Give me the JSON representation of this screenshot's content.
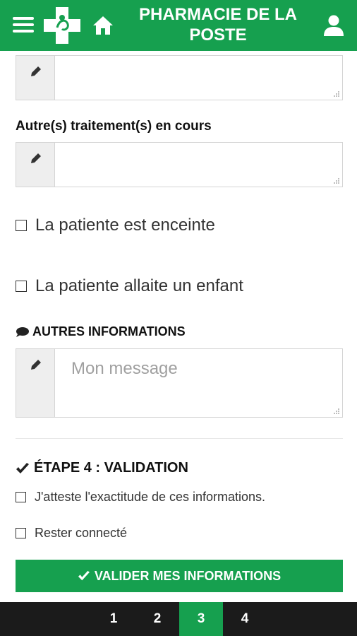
{
  "header": {
    "title": "PHARMACIE DE LA POSTE",
    "icons": {
      "menu": "hamburger-menu-icon",
      "logo": "pharmacy-cross-logo",
      "home": "home-icon",
      "user": "user-icon"
    }
  },
  "form": {
    "top_textarea": {
      "value": ""
    },
    "treatments": {
      "label": "Autre(s) traitement(s) en cours",
      "value": ""
    },
    "pregnant": {
      "label": "La patiente est enceinte",
      "checked": false
    },
    "breastfeeding": {
      "label": "La patiente allaite un enfant",
      "checked": false
    },
    "other_info": {
      "heading": "AUTRES INFORMATIONS",
      "placeholder": "Mon message",
      "value": ""
    }
  },
  "validation": {
    "heading": "ÉTAPE 4 : VALIDATION",
    "attest": {
      "label": "J'atteste l'exactitude de ces informations.",
      "checked": false
    },
    "stay_connected": {
      "label": "Rester connecté",
      "checked": false
    },
    "submit_label": "VALIDER MES INFORMATIONS"
  },
  "pager": {
    "pages": [
      "1",
      "2",
      "3",
      "4"
    ],
    "active": "3"
  },
  "colors": {
    "brand_green": "#16a04f",
    "pager_bg": "#1b1b1b"
  }
}
